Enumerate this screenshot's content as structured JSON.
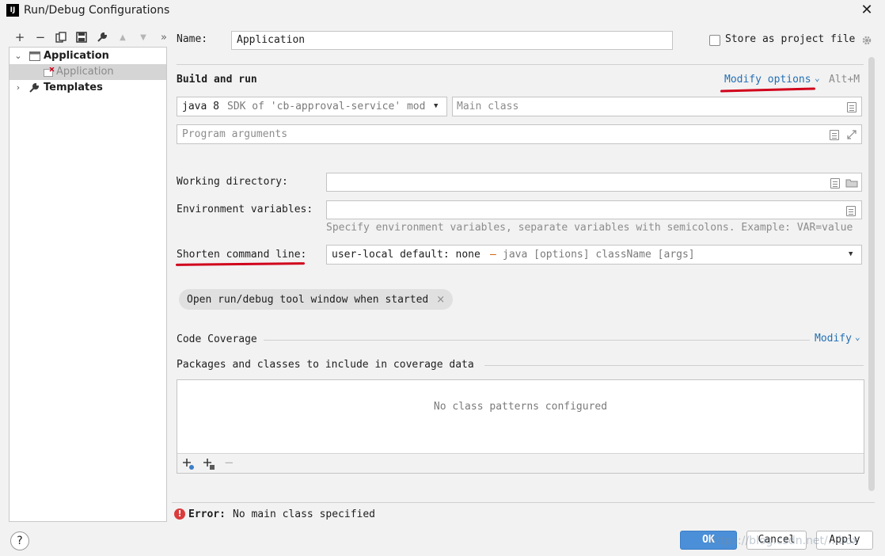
{
  "window": {
    "title": "Run/Debug Configurations",
    "app_icon_text": "IJ"
  },
  "toolbar": {
    "add": "+",
    "remove": "−",
    "copy": "⧉",
    "save": "▣",
    "wrench": "🔧",
    "up": "▲",
    "down": "▼",
    "more": "»"
  },
  "tree": {
    "app_group": "Application",
    "app_child": "Application",
    "templates": "Templates"
  },
  "name_row": {
    "label": "Name:",
    "value": "Application",
    "store_label": "Store as project file"
  },
  "build_run": {
    "heading": "Build and run",
    "modify_options": "Modify options",
    "shortcut": "Alt+M",
    "jdk_bold": "java 8",
    "jdk_rest": "SDK of 'cb-approval-service' mod",
    "main_class_placeholder": "Main class",
    "program_args_placeholder": "Program arguments"
  },
  "working_dir": {
    "label": "Working directory:",
    "value": ""
  },
  "env_vars": {
    "label": "Environment variables:",
    "value": "",
    "hint": "Specify environment variables, separate variables with semicolons. Example: VAR=value"
  },
  "shorten": {
    "label": "Shorten command line:",
    "value_main": "user-local default: none",
    "value_dash": "–",
    "value_rest": "java [options] className [args]"
  },
  "chip": {
    "label": "Open run/debug tool window when started",
    "close": "×"
  },
  "coverage": {
    "heading": "Code Coverage",
    "modify": "Modify",
    "packages_heading": "Packages and classes to include in coverage data",
    "empty_text": "No class patterns configured"
  },
  "error": {
    "icon": "!",
    "label": "Error:",
    "message": "No main class specified"
  },
  "buttons": {
    "ok": "OK",
    "cancel": "Cancel",
    "apply": "Apply",
    "help": "?"
  },
  "watermark": "https://blog.csdn.net/...box",
  "colors": {
    "accent": "#2470b3",
    "error": "#db3b3b",
    "annotation": "#d0021b",
    "primary_button": "#4a8fd8"
  }
}
